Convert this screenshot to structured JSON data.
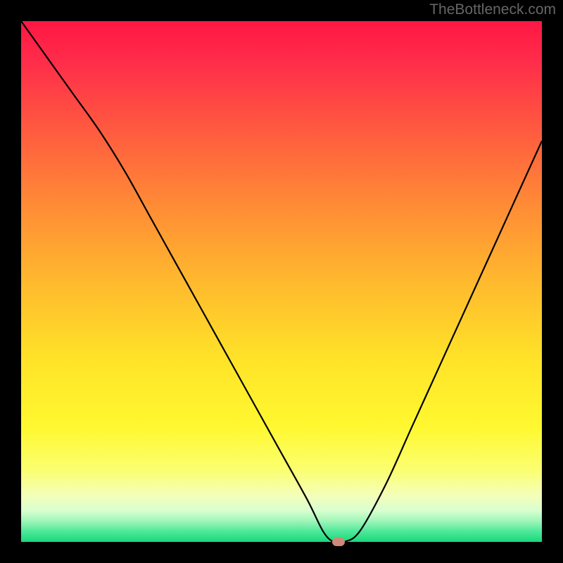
{
  "watermark": "TheBottleneck.com",
  "chart_data": {
    "type": "line",
    "title": "",
    "xlabel": "",
    "ylabel": "",
    "xlim": [
      0,
      100
    ],
    "ylim": [
      0,
      100
    ],
    "x": [
      0,
      5,
      10,
      15,
      20,
      25,
      30,
      35,
      40,
      45,
      50,
      55,
      58,
      60,
      62,
      65,
      70,
      75,
      80,
      85,
      90,
      95,
      100
    ],
    "values": [
      100,
      93,
      86,
      79,
      71,
      62,
      53,
      44,
      35,
      26,
      17,
      8,
      2,
      0,
      0,
      2,
      11,
      22,
      33,
      44,
      55,
      66,
      77
    ],
    "marker": {
      "x": 61,
      "y": 0
    },
    "gradient_stops": [
      {
        "offset": 0.0,
        "color": "#ff1744"
      },
      {
        "offset": 0.08,
        "color": "#ff2d4a"
      },
      {
        "offset": 0.2,
        "color": "#ff5740"
      },
      {
        "offset": 0.35,
        "color": "#ff8a36"
      },
      {
        "offset": 0.5,
        "color": "#ffb92e"
      },
      {
        "offset": 0.65,
        "color": "#ffe328"
      },
      {
        "offset": 0.78,
        "color": "#fff830"
      },
      {
        "offset": 0.86,
        "color": "#fbff6e"
      },
      {
        "offset": 0.91,
        "color": "#f4ffb8"
      },
      {
        "offset": 0.94,
        "color": "#d8ffd0"
      },
      {
        "offset": 0.96,
        "color": "#9ef5b8"
      },
      {
        "offset": 0.98,
        "color": "#4ee89a"
      },
      {
        "offset": 1.0,
        "color": "#18d878"
      }
    ]
  }
}
